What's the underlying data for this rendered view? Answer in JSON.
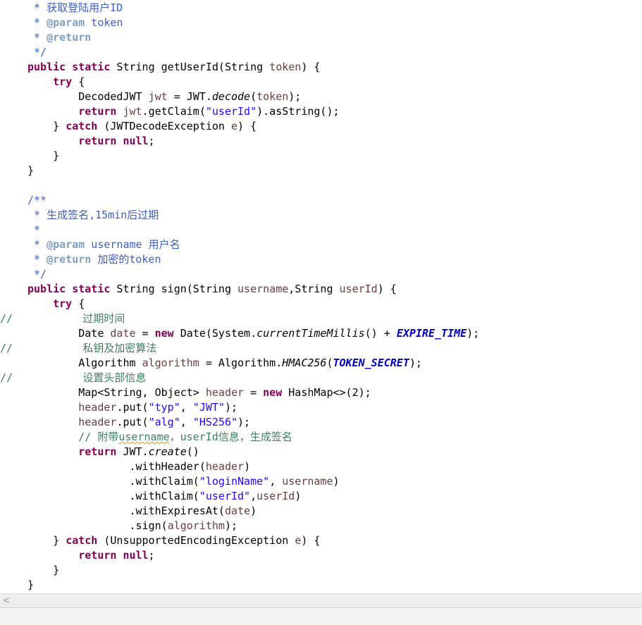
{
  "editor": {
    "lines": [
      [
        {
          "t": " * 获取登陆用户ID",
          "c": "doc"
        }
      ],
      [
        {
          "t": " * ",
          "c": "doc"
        },
        {
          "t": "@param",
          "c": "tag"
        },
        {
          "t": " token",
          "c": "doc"
        }
      ],
      [
        {
          "t": " * ",
          "c": "doc"
        },
        {
          "t": "@return",
          "c": "tag"
        }
      ],
      [
        {
          "t": " */",
          "c": "doc"
        }
      ],
      [
        {
          "t": "public",
          "c": "kw"
        },
        {
          "t": " "
        },
        {
          "t": "static",
          "c": "kw"
        },
        {
          "t": " String getUserId(String "
        },
        {
          "t": "token",
          "c": "var"
        },
        {
          "t": ") {"
        }
      ],
      [
        {
          "t": "    "
        },
        {
          "t": "try",
          "c": "kw"
        },
        {
          "t": " {"
        }
      ],
      [
        {
          "t": "        DecodedJWT "
        },
        {
          "t": "jwt",
          "c": "var"
        },
        {
          "t": " = JWT."
        },
        {
          "t": "decode",
          "c": "fn"
        },
        {
          "t": "("
        },
        {
          "t": "token",
          "c": "var"
        },
        {
          "t": ");"
        }
      ],
      [
        {
          "t": "        "
        },
        {
          "t": "return",
          "c": "kw"
        },
        {
          "t": " "
        },
        {
          "t": "jwt",
          "c": "var"
        },
        {
          "t": ".getClaim("
        },
        {
          "t": "\"userId\"",
          "c": "str"
        },
        {
          "t": ").asString();"
        }
      ],
      [
        {
          "t": "    } "
        },
        {
          "t": "catch",
          "c": "kw"
        },
        {
          "t": " (JWTDecodeException "
        },
        {
          "t": "e",
          "c": "var"
        },
        {
          "t": ") {"
        }
      ],
      [
        {
          "t": "        "
        },
        {
          "t": "return",
          "c": "kw"
        },
        {
          "t": " "
        },
        {
          "t": "null",
          "c": "kw"
        },
        {
          "t": ";"
        }
      ],
      [
        {
          "t": "    }"
        }
      ],
      [
        {
          "t": "}"
        }
      ],
      [],
      [
        {
          "t": "/**",
          "c": "doc"
        }
      ],
      [
        {
          "t": " * 生成签名,15min后过期",
          "c": "doc"
        }
      ],
      [
        {
          "t": " *",
          "c": "doc"
        }
      ],
      [
        {
          "t": " * ",
          "c": "doc"
        },
        {
          "t": "@param",
          "c": "tag"
        },
        {
          "t": " username 用户名",
          "c": "doc"
        }
      ],
      [
        {
          "t": " * ",
          "c": "doc"
        },
        {
          "t": "@return",
          "c": "tag"
        },
        {
          "t": " 加密的token",
          "c": "doc"
        }
      ],
      [
        {
          "t": " */",
          "c": "doc"
        }
      ],
      [
        {
          "t": "public",
          "c": "kw"
        },
        {
          "t": " "
        },
        {
          "t": "static",
          "c": "kw"
        },
        {
          "t": " String sign(String "
        },
        {
          "t": "username",
          "c": "var"
        },
        {
          "t": ",String "
        },
        {
          "t": "userId",
          "c": "var"
        },
        {
          "t": ") {"
        }
      ],
      [
        {
          "t": "    "
        },
        {
          "t": "try",
          "c": "kw"
        },
        {
          "t": " {"
        }
      ],
      [
        {
          "t": "//           过期时间",
          "c": "cmt"
        }
      ],
      [
        {
          "t": "        Date "
        },
        {
          "t": "date",
          "c": "var"
        },
        {
          "t": " = "
        },
        {
          "t": "new",
          "c": "kw"
        },
        {
          "t": " Date(System."
        },
        {
          "t": "currentTimeMillis",
          "c": "fn"
        },
        {
          "t": "() + "
        },
        {
          "t": "EXPIRE_TIME",
          "c": "const"
        },
        {
          "t": ");"
        }
      ],
      [
        {
          "t": "//           私钥及加密算法",
          "c": "cmt"
        }
      ],
      [
        {
          "t": "        Algorithm "
        },
        {
          "t": "algorithm",
          "c": "var"
        },
        {
          "t": " = Algorithm."
        },
        {
          "t": "HMAC256",
          "c": "fn"
        },
        {
          "t": "("
        },
        {
          "t": "TOKEN_SECRET",
          "c": "const"
        },
        {
          "t": ");"
        }
      ],
      [
        {
          "t": "//           设置头部信息",
          "c": "cmt"
        }
      ],
      [
        {
          "t": "        Map<String, Object> "
        },
        {
          "t": "header",
          "c": "var"
        },
        {
          "t": " = "
        },
        {
          "t": "new",
          "c": "kw"
        },
        {
          "t": " HashMap<>(2);"
        }
      ],
      [
        {
          "t": "        "
        },
        {
          "t": "header",
          "c": "var"
        },
        {
          "t": ".put("
        },
        {
          "t": "\"typ\"",
          "c": "str"
        },
        {
          "t": ", "
        },
        {
          "t": "\"JWT\"",
          "c": "str"
        },
        {
          "t": ");"
        }
      ],
      [
        {
          "t": "        "
        },
        {
          "t": "header",
          "c": "var"
        },
        {
          "t": ".put("
        },
        {
          "t": "\"alg\"",
          "c": "str"
        },
        {
          "t": ", "
        },
        {
          "t": "\"HS256\"",
          "c": "str"
        },
        {
          "t": ");"
        }
      ],
      [
        {
          "t": "        "
        },
        {
          "t": "// 附带",
          "c": "cmt"
        },
        {
          "t": "username",
          "c": "cmt typo"
        },
        {
          "t": "，userId信息，生成签名",
          "c": "cmt"
        }
      ],
      [
        {
          "t": "        "
        },
        {
          "t": "return",
          "c": "kw"
        },
        {
          "t": " JWT."
        },
        {
          "t": "create",
          "c": "fn"
        },
        {
          "t": "()"
        }
      ],
      [
        {
          "t": "                .withHeader("
        },
        {
          "t": "header",
          "c": "var"
        },
        {
          "t": ")"
        }
      ],
      [
        {
          "t": "                .withClaim("
        },
        {
          "t": "\"loginName\"",
          "c": "str"
        },
        {
          "t": ", "
        },
        {
          "t": "username",
          "c": "var"
        },
        {
          "t": ")"
        }
      ],
      [
        {
          "t": "                .withClaim("
        },
        {
          "t": "\"userId\"",
          "c": "str"
        },
        {
          "t": ","
        },
        {
          "t": "userId",
          "c": "var"
        },
        {
          "t": ")"
        }
      ],
      [
        {
          "t": "                .withExpiresAt("
        },
        {
          "t": "date",
          "c": "var"
        },
        {
          "t": ")"
        }
      ],
      [
        {
          "t": "                .sign("
        },
        {
          "t": "algorithm",
          "c": "var"
        },
        {
          "t": ");"
        }
      ],
      [
        {
          "t": "    } "
        },
        {
          "t": "catch",
          "c": "kw"
        },
        {
          "t": " (UnsupportedEncodingException "
        },
        {
          "t": "e",
          "c": "var"
        },
        {
          "t": ") {"
        }
      ],
      [
        {
          "t": "        "
        },
        {
          "t": "return",
          "c": "kw"
        },
        {
          "t": " "
        },
        {
          "t": "null",
          "c": "kw"
        },
        {
          "t": ";"
        }
      ],
      [
        {
          "t": "    }"
        }
      ],
      [
        {
          "t": "}"
        }
      ]
    ]
  },
  "scrollbar": {
    "left_arrow": "<"
  },
  "colors": {
    "keyword": "#7f0055",
    "string": "#2a00ff",
    "variable": "#6a3e3e",
    "constant": "#0000c0",
    "javadoc": "#3f5fbf",
    "javadoc_tag": "#7f9fbf",
    "comment": "#3f7f5f"
  }
}
